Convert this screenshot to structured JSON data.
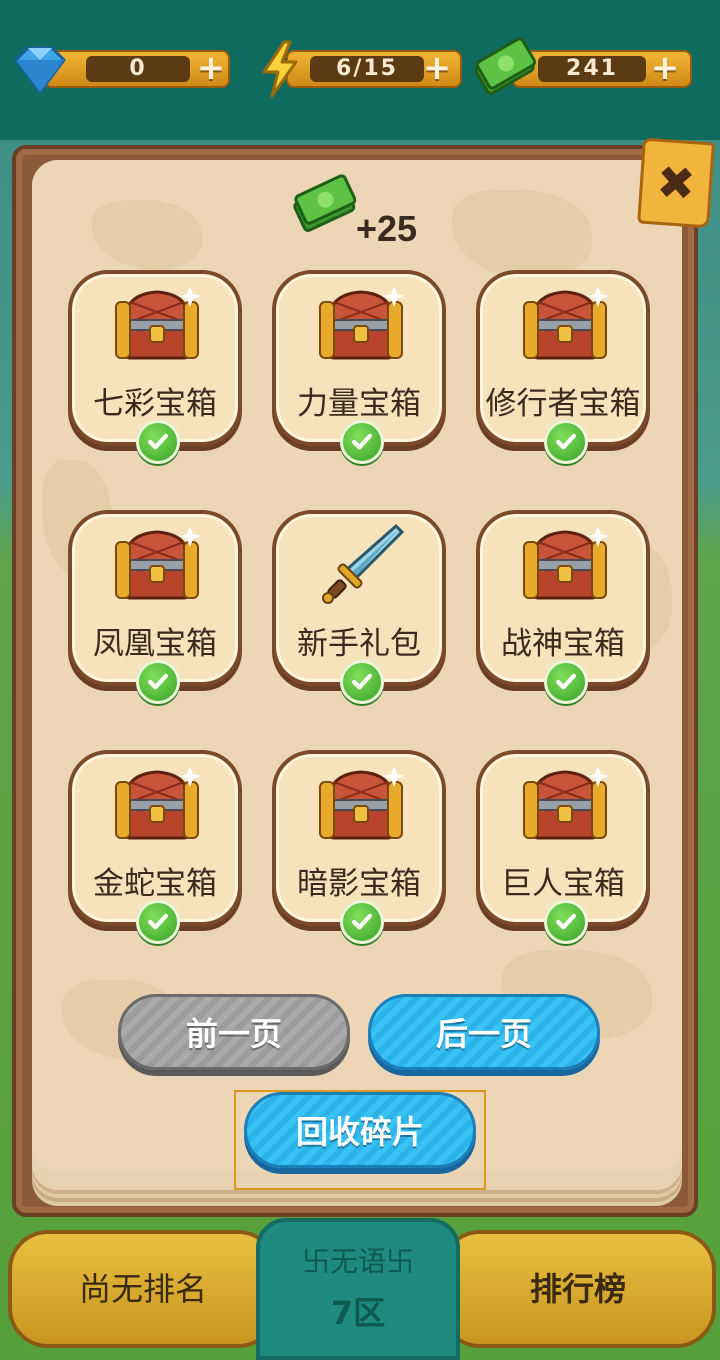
{
  "resources": {
    "gems": "0",
    "energy": "6/15",
    "cash": "241"
  },
  "reward": {
    "amount": "+25"
  },
  "items": [
    {
      "label": "七彩宝箱",
      "icon": "treasure-chest"
    },
    {
      "label": "力量宝箱",
      "icon": "treasure-chest"
    },
    {
      "label": "修行者宝箱",
      "icon": "treasure-chest"
    },
    {
      "label": "凤凰宝箱",
      "icon": "treasure-chest"
    },
    {
      "label": "新手礼包",
      "icon": "sword"
    },
    {
      "label": "战神宝箱",
      "icon": "treasure-chest"
    },
    {
      "label": "金蛇宝箱",
      "icon": "treasure-chest"
    },
    {
      "label": "暗影宝箱",
      "icon": "treasure-chest"
    },
    {
      "label": "巨人宝箱",
      "icon": "treasure-chest"
    }
  ],
  "buttons": {
    "prev": "前一页",
    "next": "后一页",
    "recycle": "回收碎片",
    "close": "✖"
  },
  "bottom": {
    "rank": "尚无排名",
    "nickname": "卐无语卐",
    "zone": "7区",
    "leaderboard": "排行榜"
  },
  "colors": {
    "accent_blue": "#2cb4ea",
    "gold": "#f2b533",
    "check_green": "#3aa12a"
  }
}
